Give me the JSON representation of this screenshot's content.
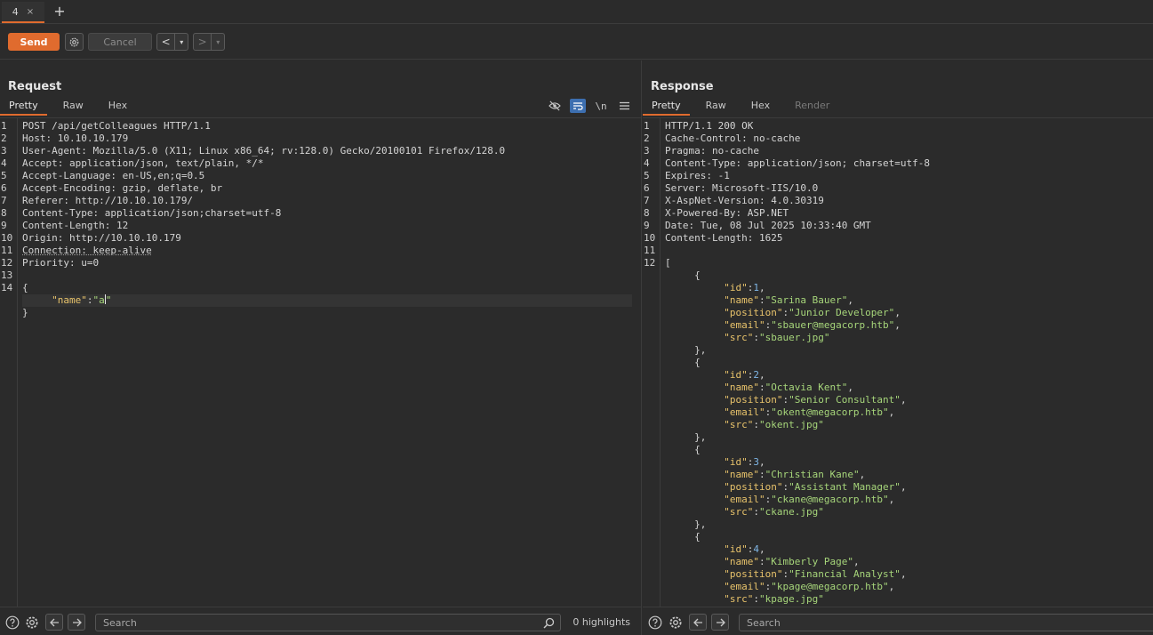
{
  "tabs": [
    {
      "label": "4",
      "close": "×"
    }
  ],
  "tab_add": "+",
  "toolbar": {
    "send_label": "Send",
    "cancel_label": "Cancel",
    "prev_label": "<",
    "next_label": ">",
    "dropdown": "▾"
  },
  "request": {
    "title": "Request",
    "tabs": [
      "Pretty",
      "Raw",
      "Hex"
    ],
    "tools": {
      "newline": "\\n"
    },
    "line_numbers": [
      "1",
      "2",
      "3",
      "4",
      "5",
      "6",
      "7",
      "8",
      "9",
      "10",
      "11",
      "12",
      "13",
      "14"
    ],
    "lines": [
      {
        "k": "POST /api/getColleagues HTTP/1.1",
        "v": ""
      },
      {
        "k": "Host:",
        "v": " 10.10.10.179"
      },
      {
        "k": "User-Agent:",
        "v": " Mozilla/5.0 (X11; Linux x86_64; rv:128.0) Gecko/20100101 Firefox/128.0"
      },
      {
        "k": "Accept:",
        "v": " application/json, text/plain, */*"
      },
      {
        "k": "Accept-Language:",
        "v": " en-US,en;q=0.5"
      },
      {
        "k": "Accept-Encoding:",
        "v": " gzip, deflate, br"
      },
      {
        "k": "Referer:",
        "v": " http://10.10.10.179/"
      },
      {
        "k": "Content-Type:",
        "v": " application/json;charset=utf-8"
      },
      {
        "k": "Content-Length:",
        "v": " 12"
      },
      {
        "k": "Origin:",
        "v": " http://10.10.10.179"
      },
      {
        "k": "Connection:",
        "v": " keep-alive"
      },
      {
        "k": "Priority:",
        "v": " u=0"
      }
    ],
    "body_open": "{",
    "body_key": "\"name\"",
    "body_colon": ":",
    "body_val_open": "\"a",
    "body_val_close": "\"",
    "body_close": "}"
  },
  "response": {
    "title": "Response",
    "tabs": [
      "Pretty",
      "Raw",
      "Hex",
      "Render"
    ],
    "line_numbers": [
      "1",
      "2",
      "3",
      "4",
      "5",
      "6",
      "7",
      "8",
      "9",
      "10",
      "11",
      "12"
    ],
    "lines": [
      {
        "k": "HTTP/1.1 200 OK",
        "v": ""
      },
      {
        "k": "Cache-Control:",
        "v": " no-cache"
      },
      {
        "k": "Pragma:",
        "v": " no-cache"
      },
      {
        "k": "Content-Type:",
        "v": " application/json; charset=utf-8"
      },
      {
        "k": "Expires:",
        "v": " -1"
      },
      {
        "k": "Server:",
        "v": " Microsoft-IIS/10.0"
      },
      {
        "k": "X-AspNet-Version:",
        "v": " 4.0.30319"
      },
      {
        "k": "X-Powered-By:",
        "v": " ASP.NET"
      },
      {
        "k": "Date:",
        "v": " Tue, 08 Jul 2025 10:33:40 GMT"
      },
      {
        "k": "Content-Length:",
        "v": " 1625"
      }
    ],
    "json_open": "[",
    "colleagues": [
      {
        "id": "1",
        "name": "\"Sarina Bauer\"",
        "position": "\"Junior Developer\"",
        "email": "\"sbauer@megacorp.htb\"",
        "src": "\"sbauer.jpg\""
      },
      {
        "id": "2",
        "name": "\"Octavia Kent\"",
        "position": "\"Senior Consultant\"",
        "email": "\"okent@megacorp.htb\"",
        "src": "\"okent.jpg\""
      },
      {
        "id": "3",
        "name": "\"Christian Kane\"",
        "position": "\"Assistant Manager\"",
        "email": "\"ckane@megacorp.htb\"",
        "src": "\"ckane.jpg\""
      },
      {
        "id": "4",
        "name": "\"Kimberly Page\"",
        "position": "\"Financial Analyst\"",
        "email": "\"kpage@megacorp.htb\"",
        "src": "\"kpage.jpg\""
      }
    ],
    "keys": {
      "id": "\"id\"",
      "name": "\"name\"",
      "position": "\"position\"",
      "email": "\"email\"",
      "src": "\"src\""
    }
  },
  "bottom": {
    "search_placeholder": "Search",
    "highlights": "0 highlights"
  },
  "colors": {
    "accent": "#e06b2e",
    "json_key": "#e8c36b",
    "json_string": "#a6d57a",
    "json_number": "#7fb6e6"
  }
}
